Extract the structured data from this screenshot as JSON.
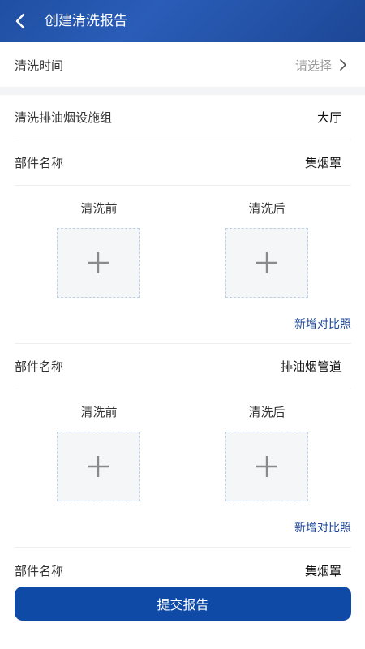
{
  "header": {
    "title": "创建清洗报告"
  },
  "clean_time": {
    "label": "清洗时间",
    "placeholder": "请选择"
  },
  "facility_group": {
    "label": "清洗排油烟设施组",
    "value": "大厅"
  },
  "parts": [
    {
      "label": "部件名称",
      "value": "集烟罩",
      "before": "清洗前",
      "after": "清洗后",
      "add_link": "新增对比照"
    },
    {
      "label": "部件名称",
      "value": "排油烟管道",
      "before": "清洗前",
      "after": "清洗后",
      "add_link": "新增对比照"
    },
    {
      "label": "部件名称",
      "value": "集烟罩"
    }
  ],
  "submit": {
    "label": "提交报告"
  },
  "colors": {
    "primary": "#0f4aa6",
    "header": "#1f4fa3",
    "link": "#1d4796"
  }
}
